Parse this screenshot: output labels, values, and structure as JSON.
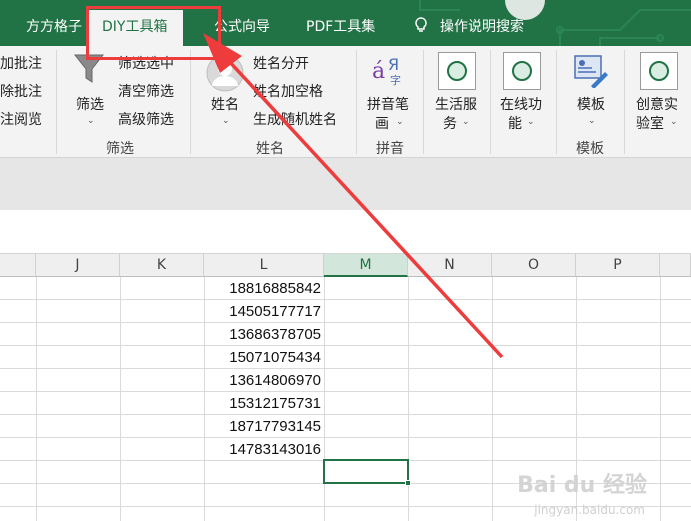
{
  "tabs": [
    {
      "label": "方方格子",
      "active": false
    },
    {
      "label": "DIY工具箱",
      "active": true
    },
    {
      "label": "公式向导",
      "active": false
    },
    {
      "label": "PDF工具集",
      "active": false
    },
    {
      "label": "操作说明搜索",
      "active": false,
      "icon": "lightbulb-icon"
    }
  ],
  "ribbon": {
    "comment_group": {
      "items": [
        "加批注",
        "除批注",
        "注阅览"
      ]
    },
    "filter_group": {
      "big_button_label": "筛选",
      "items": [
        "筛选选中",
        "清空筛选",
        "高级筛选"
      ],
      "group_label": "筛选"
    },
    "name_group": {
      "big_button_label": "姓名",
      "items": [
        "姓名分开",
        "姓名加空格",
        "生成随机姓名"
      ],
      "group_label": "姓名"
    },
    "pinyin_group": {
      "big_button_label_1": "拼音笔",
      "big_button_label_2": "画",
      "group_label": "拼音"
    },
    "life_group": {
      "label_1": "生活服",
      "label_2": "务"
    },
    "online_group": {
      "label_1": "在线功",
      "label_2": "能"
    },
    "template_group": {
      "big_button_label": "模板",
      "group_label": "模板"
    },
    "lab_group": {
      "label_1": "创意实",
      "label_2": "验室"
    },
    "caret": "⌄"
  },
  "sheet": {
    "columns": [
      "J",
      "K",
      "L",
      "M",
      "N",
      "O",
      "P"
    ],
    "selected_column": "M",
    "column_L_values": [
      "18816885842",
      "14505177717",
      "13686378705",
      "15071075434",
      "13614806970",
      "15312175731",
      "18717793145",
      "14783143016"
    ]
  },
  "watermark": {
    "brand": "Bai du 经验",
    "url": "jingyan.baidu.com"
  },
  "colors": {
    "excel_green": "#217346",
    "annotation_red": "#ee3b3b"
  }
}
